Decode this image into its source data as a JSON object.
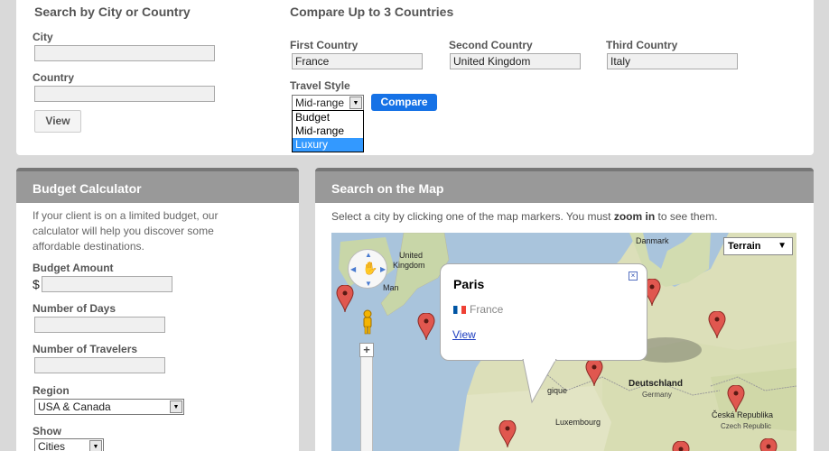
{
  "search": {
    "title": "Search by City or Country",
    "city_label": "City",
    "city_value": "",
    "country_label": "Country",
    "country_value": "",
    "view_label": "View"
  },
  "compare": {
    "title": "Compare Up to 3 Countries",
    "first_label": "First Country",
    "first_value": "France",
    "second_label": "Second Country",
    "second_value": "United Kingdom",
    "third_label": "Third Country",
    "third_value": "Italy",
    "style_label": "Travel Style",
    "style_value": "Mid-range",
    "style_options": [
      "Budget",
      "Mid-range",
      "Luxury"
    ],
    "style_highlighted": "Luxury",
    "compare_label": "Compare"
  },
  "budget": {
    "title": "Budget Calculator",
    "description": "If your client is on a limited budget, our calculator will help you discover some affordable destinations.",
    "amount_label": "Budget Amount",
    "currency_symbol": "$",
    "amount_value": "",
    "days_label": "Number of Days",
    "days_value": "",
    "travelers_label": "Number of Travelers",
    "travelers_value": "",
    "region_label": "Region",
    "region_value": "USA & Canada",
    "show_label": "Show",
    "show_value": "Cities"
  },
  "map": {
    "title": "Search on the Map",
    "desc_prefix": "Select a city by clicking one of the map markers. You must ",
    "desc_bold": "zoom in",
    "desc_suffix": " to see them.",
    "map_type": "Terrain",
    "labels": {
      "united": "United",
      "kingdom": "Kingdom",
      "man": "Man",
      "danmark": "Danmark",
      "deutschland": "Deutschland",
      "germany": "Germany",
      "luxembourg": "Luxembourg",
      "gique": "gique",
      "ceska": "Česká Republika",
      "czech": "Czech Republic"
    },
    "infowindow": {
      "city": "Paris",
      "country": "France",
      "link": "View"
    }
  }
}
